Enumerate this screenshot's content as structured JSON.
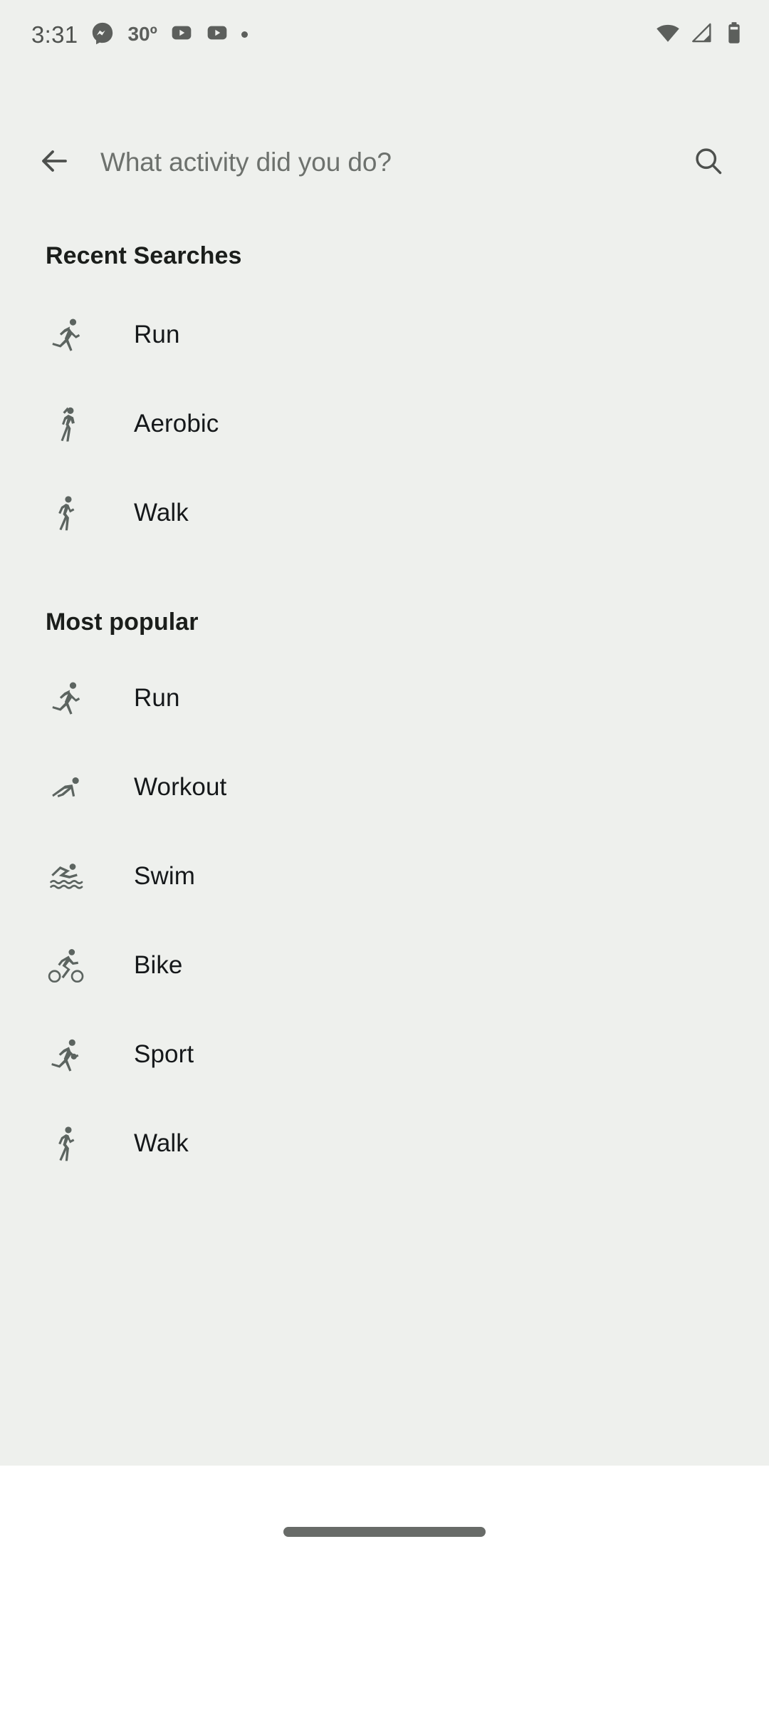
{
  "status_bar": {
    "time": "3:31",
    "temperature": "30º",
    "icons": [
      {
        "name": "messenger-icon",
        "label": "Messenger"
      },
      {
        "name": "youtube-icon",
        "label": "YouTube"
      },
      {
        "name": "youtube-icon-2",
        "label": "YouTube"
      },
      {
        "name": "notification-dot-icon",
        "label": "More notifications"
      }
    ],
    "right_icons": [
      {
        "name": "wifi-icon",
        "label": "Wi-Fi"
      },
      {
        "name": "cellular-signal-icon",
        "label": "Mobile signal"
      },
      {
        "name": "battery-icon",
        "label": "Battery"
      }
    ]
  },
  "search": {
    "placeholder": "What activity did you do?",
    "value": "",
    "back_icon": "arrow-back-icon",
    "search_icon": "search-icon"
  },
  "sections": [
    {
      "id": "recent-searches",
      "title": "Recent Searches",
      "items": [
        {
          "label": "Run",
          "icon": "run-icon"
        },
        {
          "label": "Aerobic",
          "icon": "aerobic-icon"
        },
        {
          "label": "Walk",
          "icon": "walk-icon"
        }
      ]
    },
    {
      "id": "most-popular",
      "title": "Most popular",
      "items": [
        {
          "label": "Run",
          "icon": "run-icon"
        },
        {
          "label": "Workout",
          "icon": "workout-icon"
        },
        {
          "label": "Swim",
          "icon": "swim-icon"
        },
        {
          "label": "Bike",
          "icon": "bike-icon"
        },
        {
          "label": "Sport",
          "icon": "sport-icon"
        },
        {
          "label": "Walk",
          "icon": "walk-icon"
        }
      ]
    }
  ],
  "navigation": {
    "gesture_pill": "home-gesture-pill"
  },
  "colors": {
    "background": "#eef0ed",
    "nav_background": "#ffffff",
    "text_primary": "#15181a",
    "text_placeholder": "#6d716d",
    "icon_gray": "#5c5f5c",
    "pill": "#686b68"
  }
}
